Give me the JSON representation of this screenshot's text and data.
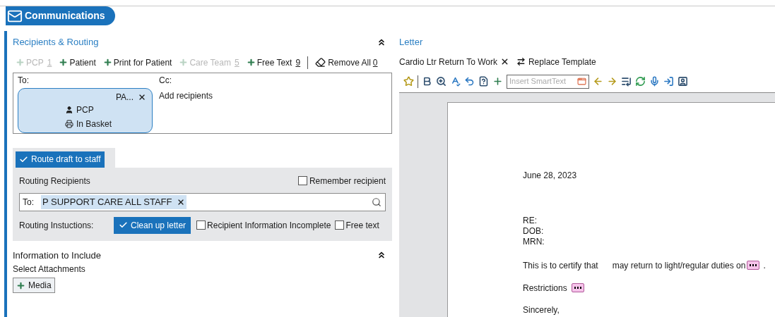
{
  "header": {
    "title": "Communications"
  },
  "recipients": {
    "title": "Recipients & Routing",
    "expanded": true,
    "actions": [
      {
        "label": "PCP",
        "count": "1",
        "disabled": true
      },
      {
        "label": "Patient",
        "disabled": false
      },
      {
        "label": "Print for Patient",
        "disabled": false
      },
      {
        "label": "Care Team",
        "count": "5",
        "disabled": true
      },
      {
        "label": "Free Text",
        "count": "9",
        "disabled": false
      }
    ],
    "remove_all": {
      "label": "Remove All",
      "count": "0"
    },
    "to_label": "To:",
    "to_card": {
      "name": "PA...",
      "role": "PCP",
      "method": "In Basket"
    },
    "cc_label": "Cc:",
    "cc_placeholder": "Add recipients"
  },
  "routing": {
    "tab": {
      "label": "Route draft to staff",
      "checked": true
    },
    "recipients_label": "Routing Recipients",
    "remember": {
      "label": "Remember recipient",
      "checked": false
    },
    "to_label": "To:",
    "to_token": "P SUPPORT CARE ALL STAFF",
    "instructions_label": "Routing Instuctions:",
    "instructions": [
      {
        "label": "Clean up letter",
        "checked": true
      },
      {
        "label": "Recipient Information Incomplete",
        "checked": false
      },
      {
        "label": "Free text",
        "checked": false
      }
    ]
  },
  "information": {
    "title": "Information to Include",
    "expanded": true,
    "subtitle": "Select Attachments",
    "button": "Media"
  },
  "letter": {
    "title": "Letter",
    "template": "Cardio Ltr Return To Work",
    "replace": "Replace Template",
    "smarttext_placeholder": "Insert SmartText",
    "date": "June 28, 2023",
    "fields": [
      "RE:",
      "DOB:",
      "MRN:"
    ],
    "certify_start": "This is to certify that",
    "certify_end": "may return to light/regular duties on",
    "certify_period": ".",
    "restrictions": "Restrictions",
    "closing": "Sincerely,"
  }
}
